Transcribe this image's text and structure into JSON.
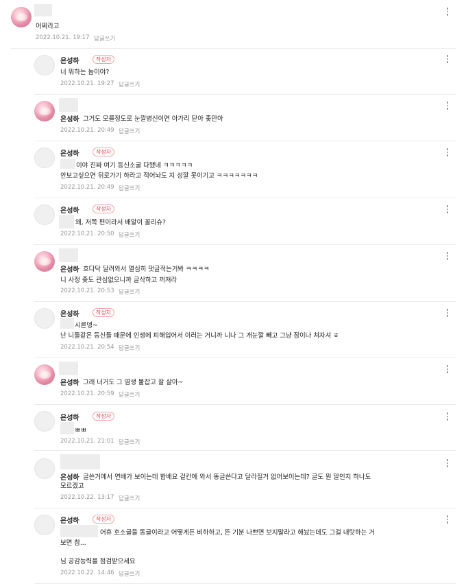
{
  "reply_label": "답글쓰기",
  "author_badge": "작성자",
  "comments": [
    {
      "nick": "",
      "text1": "어쩌라고",
      "text2": "",
      "date": "2022.10.21. 19:17"
    },
    {
      "nick": "은성하",
      "text1": "너 뭐하는 놈이야?",
      "text2": "",
      "date": "2022.10.21. 19:27"
    },
    {
      "nick": "은성하",
      "text1": "그거도 모를정도로 눈깔병신이면 아가리 닫아 좆만아",
      "text2": "",
      "date": "2022.10.21. 20:49"
    },
    {
      "nick": "은성하",
      "text1": "이야 진짜 여기 등신소굴 다됐네 ㅋㅋㅋㅋㅋ",
      "text2": "안보고싶으면 뒤로가기 하라고 적어놔도 지 성깔 못이기고 ㅋㅋㅋㅋㅋㅋㅋ",
      "date": "2022.10.21. 20:49"
    },
    {
      "nick": "은성하",
      "text1": "왜, 저쪽 편이라서 배알이 꼴리슈?",
      "text2": "",
      "date": "2022.10.21. 20:50"
    },
    {
      "nick": "은성하",
      "text1": "흐다닥 달려와서 열심히 댓글적는거봐 ㅋㅋㅋㅋ",
      "text2": "니 사정 좆도 관심없으니까 글삭하고 꺼져라",
      "date": "2022.10.21. 20:53"
    },
    {
      "nick": "은성하",
      "text1": "시른뎅~",
      "text2": "난 니들같은 등신들 때문에 인생에 피해입어서 이러는 거니까 니나 그 개눈깔 빼고 그냥 잠이나 쳐자셔 ㅎ",
      "date": "2022.10.21. 20:54"
    },
    {
      "nick": "은성하",
      "text1": "그래 너거도 그 염생 불잡고 잘 살아~",
      "text2": "",
      "date": "2022.10.21. 20:59"
    },
    {
      "nick": "은성하",
      "text1": "ㅃㅃ",
      "text2": "",
      "date": "2022.10.21. 21:01"
    },
    {
      "nick": "은성하",
      "text1": "글쓴거에서 연배가 보이는데 함배요 겉칸에 와서 똥글쓴다고 달라질거 없어보이는데? 글도 뭔 말인지 하나도",
      "text2": "모르겠고",
      "date": "2022.10.22. 13:17"
    },
    {
      "nick": "은성하",
      "text1": "어휴 호소글을 똥글이라고 어떻게든 비하하고, 뜬 기분 나쁘면 보지말라고 해놨는데도 그걸 내탓하는 거",
      "text2": "보면 참...",
      "text3": "님 공감능력을 점검받으세요",
      "date": "2022.10.22. 14:46"
    }
  ]
}
